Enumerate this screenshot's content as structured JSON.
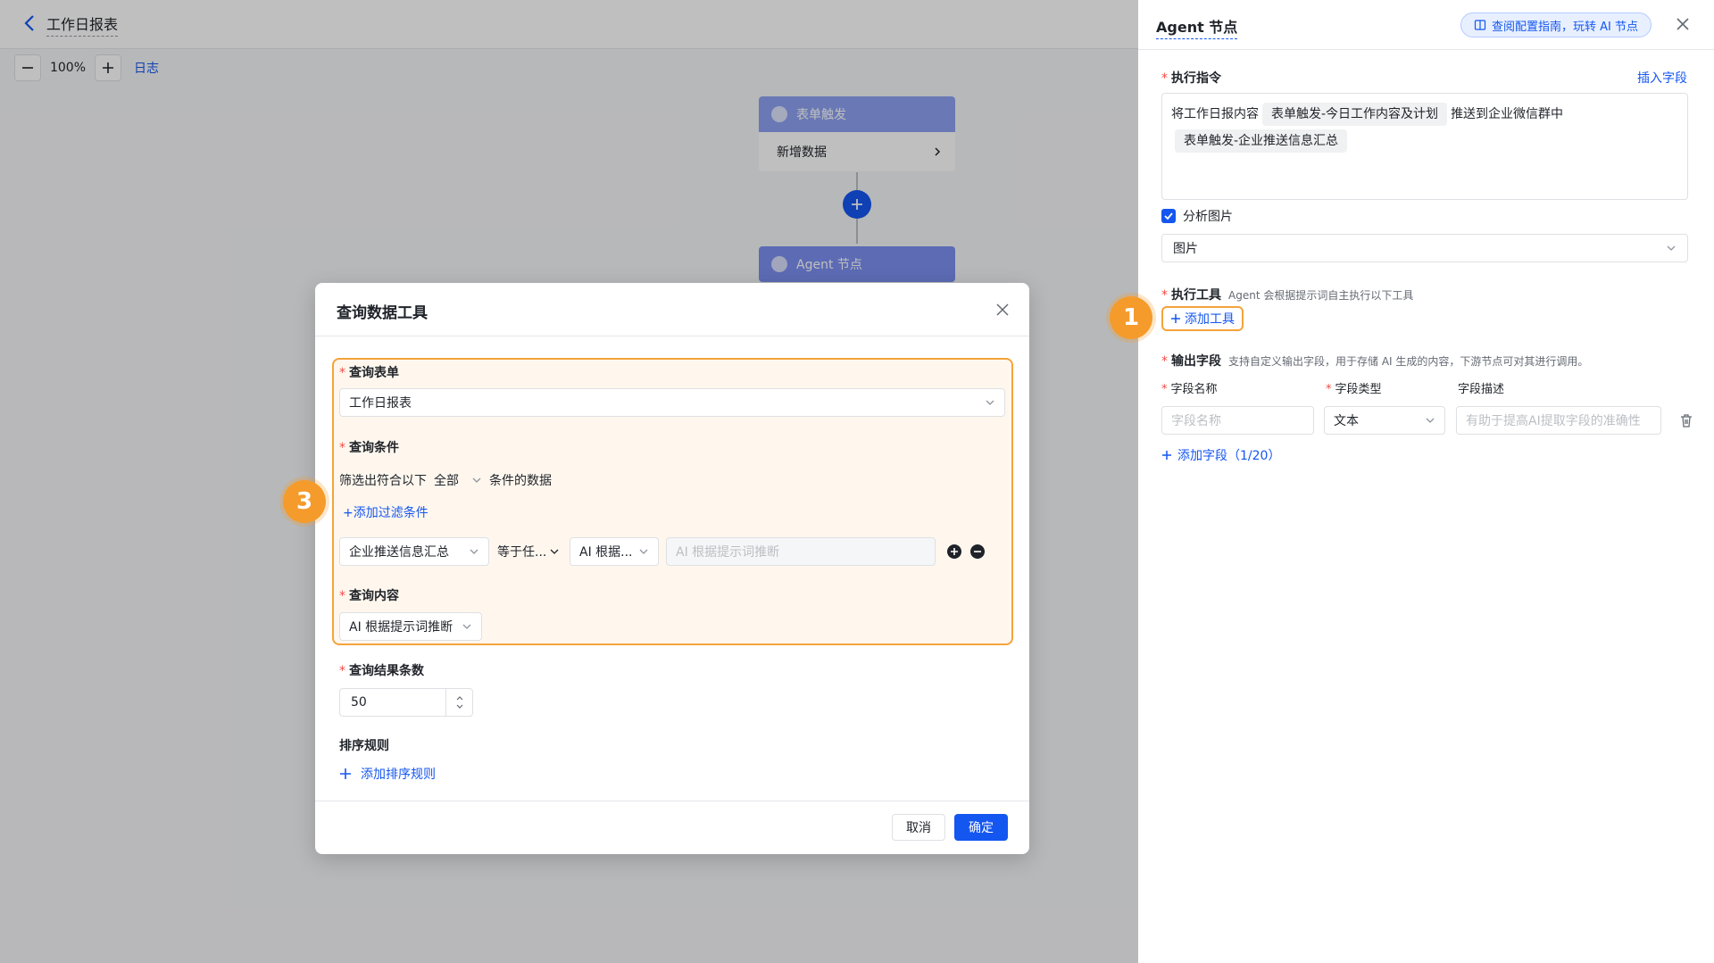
{
  "canvas": {
    "title": "工作日报表",
    "zoom": "100%",
    "log_link": "日志",
    "nodes": {
      "trigger_title": "表单触发",
      "trigger_action": "新增数据",
      "agent_title": "Agent 节点"
    }
  },
  "drawer": {
    "title": "Agent 节点",
    "guide_link": "查阅配置指南，玩转 AI 节点",
    "instruction_label": "执行指令",
    "insert_field": "插入字段",
    "instruction": {
      "text_before": "将工作日报内容",
      "chip1": "表单触发-今日工作内容及计划",
      "text_middle": "推送到企业微信群中",
      "chip2": "表单触发-企业推送信息汇总"
    },
    "analyze_image_label": "分析图片",
    "image_select_value": "图片",
    "tools_label": "执行工具",
    "tools_hint": "Agent 会根据提示词自主执行以下工具",
    "add_tool": "添加工具",
    "output_label": "输出字段",
    "output_hint": "支持自定义输出字段，用于存储 AI 生成的内容，下游节点可对其进行调用。",
    "col_name": "字段名称",
    "col_type": "字段类型",
    "col_desc": "字段描述",
    "name_placeholder": "字段名称",
    "type_value": "文本",
    "desc_placeholder": "有助于提高AI提取字段的准确性",
    "add_field": "添加字段（1/20）"
  },
  "modal": {
    "title": "查询数据工具",
    "form_label": "查询表单",
    "form_value": "工作日报表",
    "condition_label": "查询条件",
    "filter_prefix": "筛选出符合以下",
    "filter_scope": "全部",
    "filter_suffix": "条件的数据",
    "add_filter": "+添加过滤条件",
    "cond_field": "企业推送信息汇总",
    "cond_op": "等于任...",
    "cond_source": "AI 根据...",
    "cond_value_placeholder": "AI 根据提示词推断",
    "content_label": "查询内容",
    "content_value": "AI 根据提示词推断",
    "count_label": "查询结果条数",
    "count_value": "50",
    "sort_label": "排序规则",
    "add_sort": "添加排序规则",
    "cancel": "取消",
    "ok": "确定"
  },
  "badges": {
    "one": "1",
    "three": "3"
  },
  "colors": {
    "accent": "#1456f0",
    "highlight": "#f5a33b",
    "badge": "#f59b2b"
  }
}
